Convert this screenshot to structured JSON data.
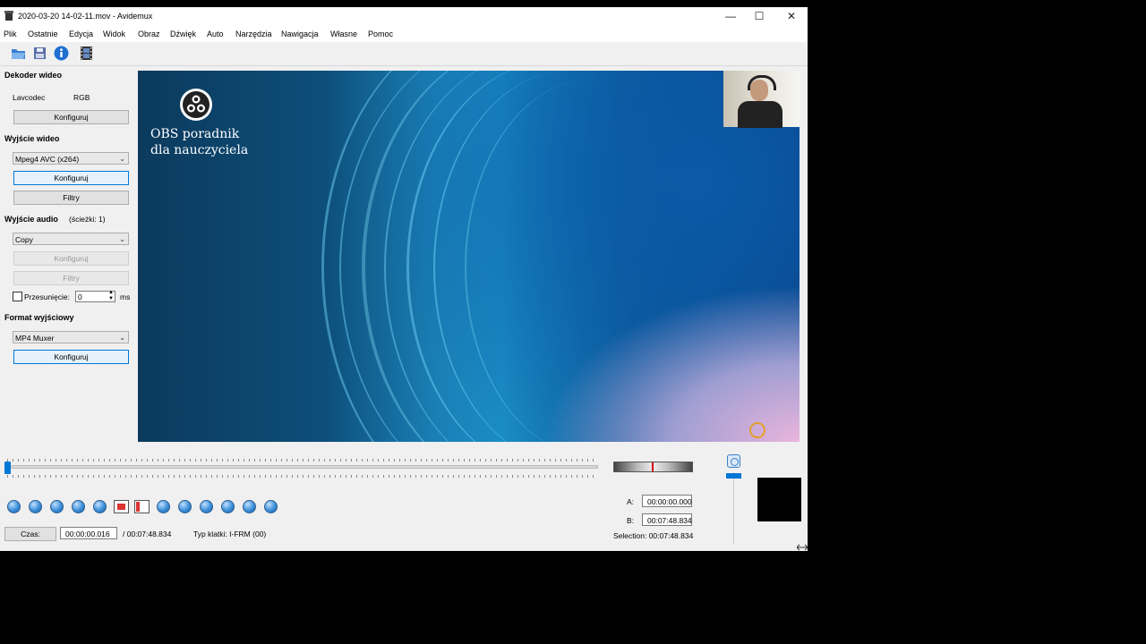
{
  "window": {
    "title": "2020-03-20 14-02-11.mov - Avidemux",
    "controls": {
      "minimize": "—",
      "maximize": "☐",
      "close": "✕"
    }
  },
  "menu": [
    "Plik",
    "Ostatnie",
    "Edycja",
    "Widok",
    "Obraz",
    "Dźwięk",
    "Auto",
    "Narzędzia",
    "Nawigacja",
    "Własne",
    "Pomoc"
  ],
  "toolbar": {
    "icons": [
      "open-icon",
      "save-icon",
      "info-icon",
      "film-icon"
    ]
  },
  "left": {
    "video_decoder": {
      "header": "Dekoder wideo",
      "decoder": "Lavcodec",
      "format": "RGB",
      "configure": "Konfiguruj"
    },
    "video_output": {
      "header": "Wyjście wideo",
      "codec": "Mpeg4 AVC (x264)",
      "configure": "Konfiguruj",
      "filters": "Filtry"
    },
    "audio_output": {
      "header": "Wyjście audio",
      "tracks": "(ścieżki: 1)",
      "codec": "Copy",
      "configure": "Konfiguruj",
      "filters": "Filtry",
      "shift_label": "Przesunięcie:",
      "shift_value": "0",
      "shift_unit": "ms"
    },
    "output_format": {
      "header": "Format wyjściowy",
      "muxer": "MP4 Muxer",
      "configure": "Konfiguruj"
    }
  },
  "video": {
    "line1": "OBS poradnik",
    "line2": "dla nauczyciela"
  },
  "bottom": {
    "time_label": "Czas:",
    "current_time": "00:00:00.016",
    "total_time": "/ 00:07:48.834",
    "frame_type": "Typ klatki:  I-FRM (00)",
    "marker_a_label": "A:",
    "marker_a": "00:00:00.000",
    "marker_b_label": "B:",
    "marker_b": "00:07:48.834",
    "selection": "Selection: 00:07:48.834",
    "slider_position": 0.0
  },
  "colors": {
    "accent": "#0078d7",
    "window_bg": "#f0f0f0"
  }
}
